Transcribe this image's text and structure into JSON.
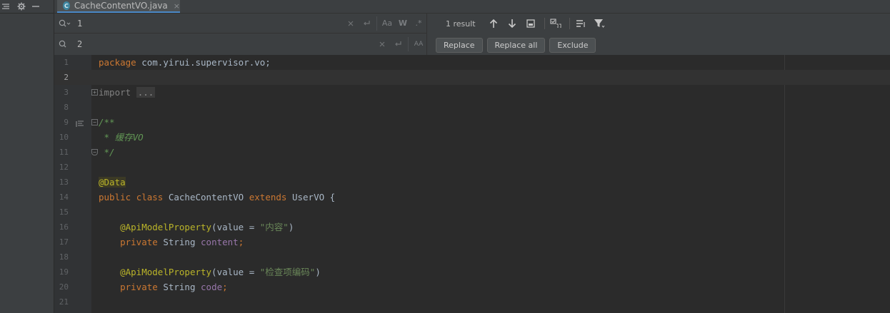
{
  "tab": {
    "label": "CacheContentVO.java",
    "icon": "class-icon",
    "close": "×"
  },
  "find": {
    "value": "1"
  },
  "replace": {
    "value": "2"
  },
  "find_options": {
    "match_case": "Aa",
    "words": "W",
    "regex": ".*"
  },
  "replace_options": {
    "preserve_case": "AA"
  },
  "status": {
    "result_count": "1 result"
  },
  "actions": {
    "replace": "Replace",
    "replace_all": "Replace all",
    "exclude": "Exclude"
  },
  "editor": {
    "lines": [
      {
        "n": "1"
      },
      {
        "n": "2"
      },
      {
        "n": "3"
      },
      {
        "n": "8"
      },
      {
        "n": "9"
      },
      {
        "n": "10"
      },
      {
        "n": "11"
      },
      {
        "n": "12"
      },
      {
        "n": "13"
      },
      {
        "n": "14"
      },
      {
        "n": "15"
      },
      {
        "n": "16"
      },
      {
        "n": "17"
      },
      {
        "n": "18"
      },
      {
        "n": "19"
      },
      {
        "n": "20"
      },
      {
        "n": "21"
      }
    ],
    "code": {
      "l1_kw": "package",
      "l1_rest": " com.yirui.supervisor.vo;",
      "l3_kw": "import",
      "l3_fold": "...",
      "l9": "/**",
      "l10": " * 缓存VO",
      "l11": " */",
      "l13": "@Data",
      "l14_public": "public",
      "l14_class": "class",
      "l14_name": " CacheContentVO ",
      "l14_extends": "extends",
      "l14_rest": " UserVO {",
      "l16_ann": "@ApiModelProperty",
      "l16_open": "(value = ",
      "l16_str": "\"内容\"",
      "l16_close": ")",
      "l17_private": "private",
      "l17_type": " String ",
      "l17_field": "content",
      "l17_end": ";",
      "l19_ann": "@ApiModelProperty",
      "l19_open": "(value = ",
      "l19_str": "\"检查项编码\"",
      "l19_close": ")",
      "l20_private": "private",
      "l20_type": " String ",
      "l20_field": "code",
      "l20_end": ";"
    }
  }
}
